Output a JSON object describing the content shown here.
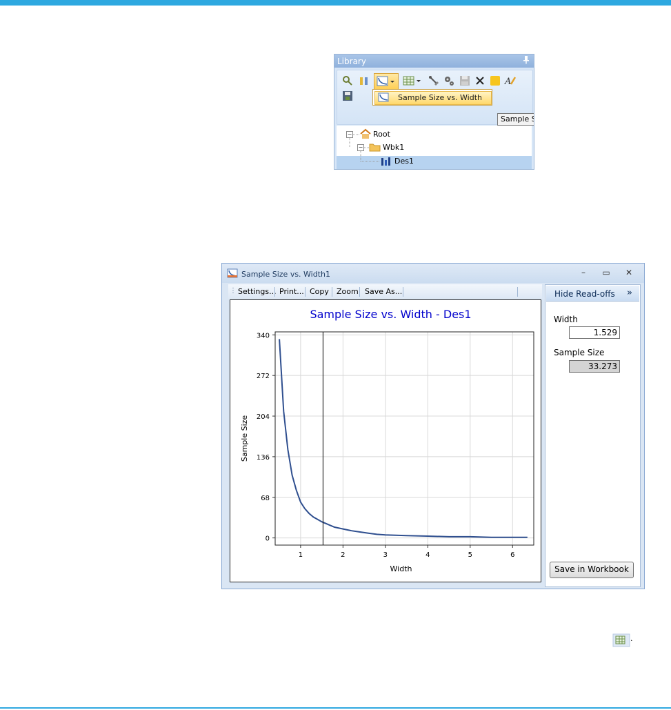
{
  "colors": {
    "accent_bar": "#2ea8e0",
    "chart_title": "#0000cc",
    "curve": "#2f4f8f"
  },
  "library": {
    "title": "Library",
    "pin_glyph": "📌",
    "toolbar_icons": [
      "search-icon",
      "bar-chart-icon",
      "curve-chart-icon",
      "table-icon",
      "tools-icon",
      "gears-icon",
      "save-icon",
      "delete-icon",
      "note-icon",
      "font-style-icon",
      "disk-save-icon"
    ],
    "dropdown_item": "Sample Size vs. Width",
    "tooltip": "Sample Si",
    "tree": [
      {
        "label": "Root",
        "icon": "home-icon"
      },
      {
        "label": "Wbk1",
        "icon": "folder-icon"
      },
      {
        "label": "Des1",
        "icon": "design-icon"
      }
    ]
  },
  "window": {
    "title": "Sample Size vs. Width1",
    "controls": {
      "minimize": "–",
      "maximize": "▭",
      "close": "✕"
    },
    "toolbar": [
      "Settings...",
      "Print...",
      "Copy",
      "Zoom",
      "Save As..."
    ]
  },
  "readoffs": {
    "hide_label": "Hide Read-offs",
    "hide_arrow": "»",
    "width_label": "Width",
    "width_value": "1.529",
    "sample_label": "Sample Size",
    "sample_value": "33.273",
    "save_label": "Save in Workbook"
  },
  "chart_data": {
    "type": "line",
    "title": "Sample Size vs. Width - Des1",
    "xlabel": "Width",
    "ylabel": "Sample Size",
    "xlim": [
      0.4,
      6.5
    ],
    "ylim": [
      -12,
      345
    ],
    "xticks": [
      1,
      2,
      3,
      4,
      5,
      6
    ],
    "yticks": [
      0,
      68,
      136,
      204,
      272,
      340
    ],
    "grid": true,
    "cursor_x": 1.529,
    "series": [
      {
        "x": [
          0.5,
          0.6,
          0.7,
          0.8,
          0.9,
          1.0,
          1.1,
          1.2,
          1.3,
          1.4,
          1.5,
          1.6,
          1.7,
          1.8,
          2.0,
          2.2,
          2.4,
          2.6,
          2.8,
          3.0,
          3.5,
          4.0,
          4.5,
          5.0,
          5.5,
          6.0,
          6.35
        ],
        "values": [
          333,
          212,
          148,
          105,
          80,
          60,
          49,
          41,
          35,
          31,
          27,
          24,
          21,
          18,
          15,
          12,
          10,
          8,
          6,
          5,
          4,
          3,
          2,
          2,
          1,
          1,
          1
        ]
      }
    ]
  },
  "bottom_icon": "table-dropdown-icon"
}
